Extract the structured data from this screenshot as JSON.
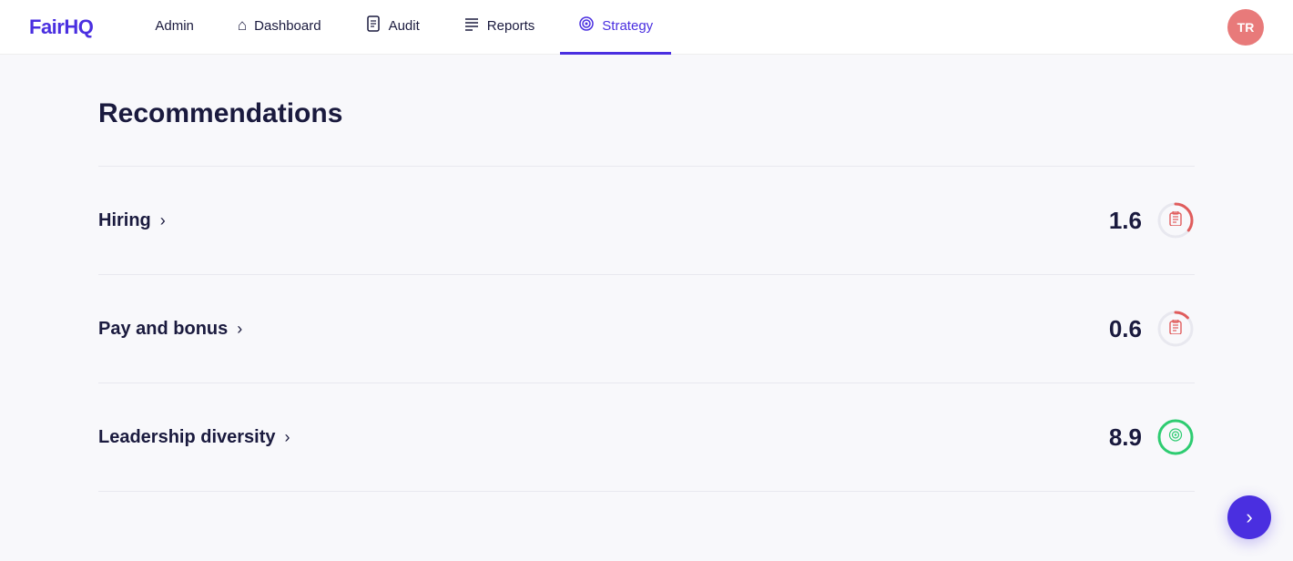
{
  "logo": "FairHQ",
  "nav": {
    "links": [
      {
        "id": "admin",
        "label": "Admin",
        "icon": "",
        "active": false
      },
      {
        "id": "dashboard",
        "label": "Dashboard",
        "icon": "⌂",
        "active": false
      },
      {
        "id": "audit",
        "label": "Audit",
        "icon": "📋",
        "active": false
      },
      {
        "id": "reports",
        "label": "Reports",
        "icon": "☰",
        "active": false
      },
      {
        "id": "strategy",
        "label": "Strategy",
        "icon": "◎",
        "active": true
      }
    ],
    "avatar": "TR"
  },
  "page": {
    "title": "Recommendations",
    "items": [
      {
        "id": "hiring",
        "label": "Hiring",
        "score": "1.6",
        "status": "red"
      },
      {
        "id": "pay-and-bonus",
        "label": "Pay and bonus",
        "score": "0.6",
        "status": "red-partial"
      },
      {
        "id": "leadership-diversity",
        "label": "Leadership diversity",
        "score": "8.9",
        "status": "green"
      }
    ]
  }
}
